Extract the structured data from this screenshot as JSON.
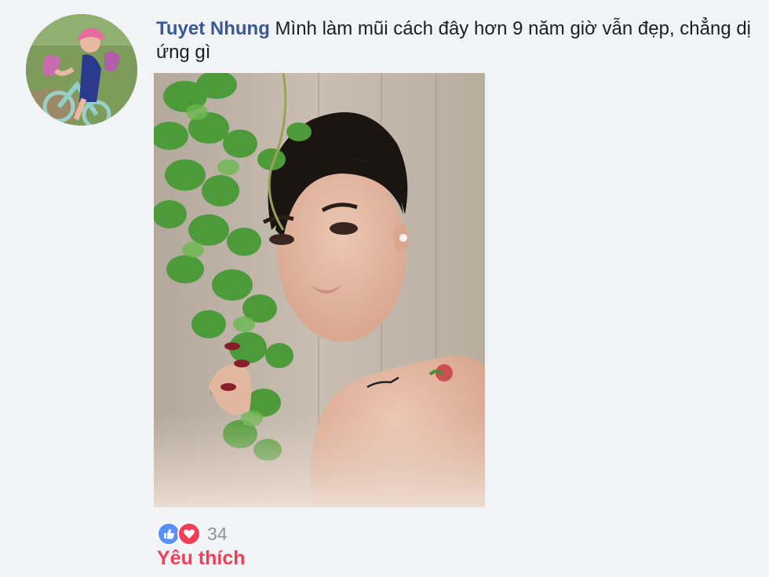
{
  "comment": {
    "author_name": "Tuyet Nhung",
    "text": "Mình làm mũi cách đây hơn 9 năm giờ vẫn đẹp, chẳng dị ứng gì"
  },
  "reactions": {
    "icons": [
      "like-icon",
      "love-icon"
    ],
    "count": "34",
    "colors": {
      "like": "#5890ff",
      "love": "#f33e58"
    }
  },
  "actions": {
    "like_label": "Yêu thích"
  },
  "colors": {
    "author": "#385898",
    "background": "#f2f3f5",
    "action": "#f33e58"
  }
}
